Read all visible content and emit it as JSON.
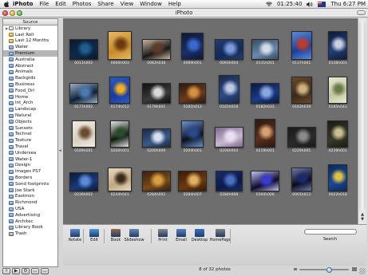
{
  "menubar": {
    "app": "iPhoto",
    "items": [
      "File",
      "Edit",
      "Photos",
      "Share",
      "View",
      "Window",
      "Help"
    ],
    "clock": "01:25:40",
    "day_time": "Thu 6:27 PM"
  },
  "window": {
    "title": "iPhoto"
  },
  "sidebar": {
    "header": "Source",
    "albums": [
      {
        "label": "Library",
        "kind": "library",
        "tri": "▶"
      },
      {
        "label": "Last Roll",
        "kind": "roll"
      },
      {
        "label": "Last 12 Months",
        "kind": "roll"
      },
      {
        "label": "Water",
        "kind": "album"
      },
      {
        "label": "Premium",
        "kind": "album",
        "selected": true
      },
      {
        "label": "Australia",
        "kind": "album"
      },
      {
        "label": "Abstract",
        "kind": "album"
      },
      {
        "label": "Animals",
        "kind": "album"
      },
      {
        "label": "Backgrds",
        "kind": "album"
      },
      {
        "label": "Business",
        "kind": "album"
      },
      {
        "label": "Food_Drl",
        "kind": "album"
      },
      {
        "label": "Home",
        "kind": "album"
      },
      {
        "label": "Int_Arch",
        "kind": "album"
      },
      {
        "label": "Landscap",
        "kind": "album"
      },
      {
        "label": "Natural",
        "kind": "album"
      },
      {
        "label": "Objects",
        "kind": "album"
      },
      {
        "label": "Sunsets",
        "kind": "album"
      },
      {
        "label": "Technol",
        "kind": "album"
      },
      {
        "label": "Texture",
        "kind": "album"
      },
      {
        "label": "Travel",
        "kind": "album"
      },
      {
        "label": "Undersea",
        "kind": "album"
      },
      {
        "label": "Water-1",
        "kind": "album"
      },
      {
        "label": "Design",
        "kind": "album"
      },
      {
        "label": "Images PS7",
        "kind": "album"
      },
      {
        "label": "Borders",
        "kind": "album"
      },
      {
        "label": "Sond footprints",
        "kind": "album"
      },
      {
        "label": "Joe Stark",
        "kind": "album"
      },
      {
        "label": "Eastmon",
        "kind": "album"
      },
      {
        "label": "Richmond",
        "kind": "album"
      },
      {
        "label": "USA",
        "kind": "album"
      },
      {
        "label": "Advertising",
        "kind": "album"
      },
      {
        "label": "Architec",
        "kind": "album"
      },
      {
        "label": "Library Book",
        "kind": "album"
      },
      {
        "label": "Trash",
        "kind": "trash"
      }
    ],
    "tools": [
      "+",
      "▶",
      "⚙",
      "▭",
      "▭"
    ]
  },
  "photos": [
    {
      "label": "0011h002",
      "colors": [
        "#0d2a4a",
        "#1f5f8e",
        "#0a1a2e"
      ]
    },
    {
      "label": "0066h003",
      "colors": [
        "#c58a2a",
        "#6b3a10",
        "#e6b860"
      ]
    },
    {
      "label": "0082h038",
      "colors": [
        "#181818",
        "#5a3a2a",
        "#c9b29a"
      ]
    },
    {
      "label": "0089h001",
      "colors": [
        "#1a2f6a",
        "#3a6ad0",
        "#0d1838"
      ]
    },
    {
      "label": "0093h004",
      "colors": [
        "#102a5a",
        "#7a9ad8",
        "#263a70"
      ]
    },
    {
      "label": "0131h001",
      "colors": [
        "#6a8ab0",
        "#d4dce8",
        "#3a4a60"
      ]
    },
    {
      "label": "0137h001",
      "colors": [
        "#1a3f9a",
        "#c03a2a",
        "#5a88d8"
      ]
    },
    {
      "label": "0138h001",
      "colors": [
        "#24407a",
        "#c8d0e0",
        "#0d1a3a"
      ]
    },
    {
      "label": "0171h002",
      "colors": [
        "#0e2038",
        "#4a7ab0",
        "#9ab0c8"
      ]
    },
    {
      "label": "0174h012",
      "colors": [
        "#1a3a9a",
        "#f0b020",
        "#2a5ac0"
      ]
    },
    {
      "label": "0179h001",
      "colors": [
        "#3a3a3a",
        "#d8d8d8",
        "#101010"
      ]
    },
    {
      "label": "0181h013",
      "colors": [
        "#6a3a1a",
        "#d89040",
        "#2a1a10"
      ]
    },
    {
      "label": "0181h018",
      "colors": [
        "#2a4a8a",
        "#c0c8e0",
        "#1a2a4a"
      ]
    },
    {
      "label": "0182h032",
      "colors": [
        "#1a3a8a",
        "#8aa8e0",
        "#0a1a40"
      ]
    },
    {
      "label": "0183h039",
      "colors": [
        "#3a2a1a",
        "#d0b080",
        "#6a4a2a"
      ]
    },
    {
      "label": "0185h043",
      "colors": [
        "#c0c8a0",
        "#6a7a4a",
        "#e8e8d0"
      ]
    },
    {
      "label": "0189h001",
      "colors": [
        "#d8d0c0",
        "#6a4a30",
        "#f0ece0"
      ]
    },
    {
      "label": "0200h001",
      "colors": [
        "#0a1a0a",
        "#2a4a2a",
        "#e0e0e0"
      ]
    },
    {
      "label": "0200h009",
      "colors": [
        "#3a5a8a",
        "#d8e0f0",
        "#1a2a40"
      ]
    },
    {
      "label": "0204h001",
      "colors": [
        "#0a1020",
        "#2a4a8a",
        "#6a90d0"
      ]
    },
    {
      "label": "0204h004",
      "colors": [
        "#c8b8d0",
        "#e8e0f0",
        "#806a90"
      ]
    },
    {
      "label": "0219h001",
      "colors": [
        "#5a3020",
        "#d8a070",
        "#2a1810"
      ]
    },
    {
      "label": "0229h001",
      "colors": [
        "#2a2a2a",
        "#8a8a8a",
        "#1a1a1a"
      ]
    },
    {
      "label": "0239h001",
      "colors": [
        "#3a3a2a",
        "#c8c090",
        "#1a1a10"
      ]
    },
    {
      "label": "0236h002",
      "colors": [
        "#1a3a7a",
        "#5a8ad8",
        "#0a1a3a"
      ]
    },
    {
      "label": "0244h041",
      "colors": [
        "#c0a880",
        "#3a2a1a",
        "#e8d8c0"
      ]
    },
    {
      "label": "0284h002",
      "colors": [
        "#7a4a1a",
        "#d8a040",
        "#3a2010"
      ]
    },
    {
      "label": "0284h007",
      "colors": [
        "#6a3a10",
        "#e0b060",
        "#3a1a08"
      ]
    },
    {
      "label": "0284h008",
      "colors": [
        "#0a1a4a",
        "#4a70c0",
        "#1a2a6a"
      ]
    },
    {
      "label": "0300h006",
      "colors": [
        "#0a0a2a",
        "#3a3ad0",
        "#c0c0f0"
      ]
    },
    {
      "label": "0001h013",
      "colors": [
        "#0a0a1a",
        "#1a2a6a",
        "#6a7ab0"
      ]
    },
    {
      "label": "0022h018",
      "colors": [
        "#1a4a9a",
        "#e0c040",
        "#0a2a5a"
      ]
    }
  ],
  "tools": [
    {
      "label": "Rotate",
      "color": "#5a8ad0"
    },
    {
      "label": "Edit",
      "color": "#4a9ad8"
    },
    {
      "label": "Book",
      "color": "#9a6a4a"
    },
    {
      "label": "Slideshow",
      "color": "#6a8ab0"
    },
    {
      "label": "Print",
      "color": "#8a8a8a"
    },
    {
      "label": "Email",
      "color": "#5a80c8"
    },
    {
      "label": "Desktop",
      "color": "#3a70c8"
    },
    {
      "label": "HomePage",
      "color": "#808080"
    }
  ],
  "search": {
    "placeholder": "",
    "label": "Search"
  },
  "status": {
    "text": "8 of 32 photos",
    "zoom_level": 0.6
  },
  "accent": "#4a6aa0"
}
